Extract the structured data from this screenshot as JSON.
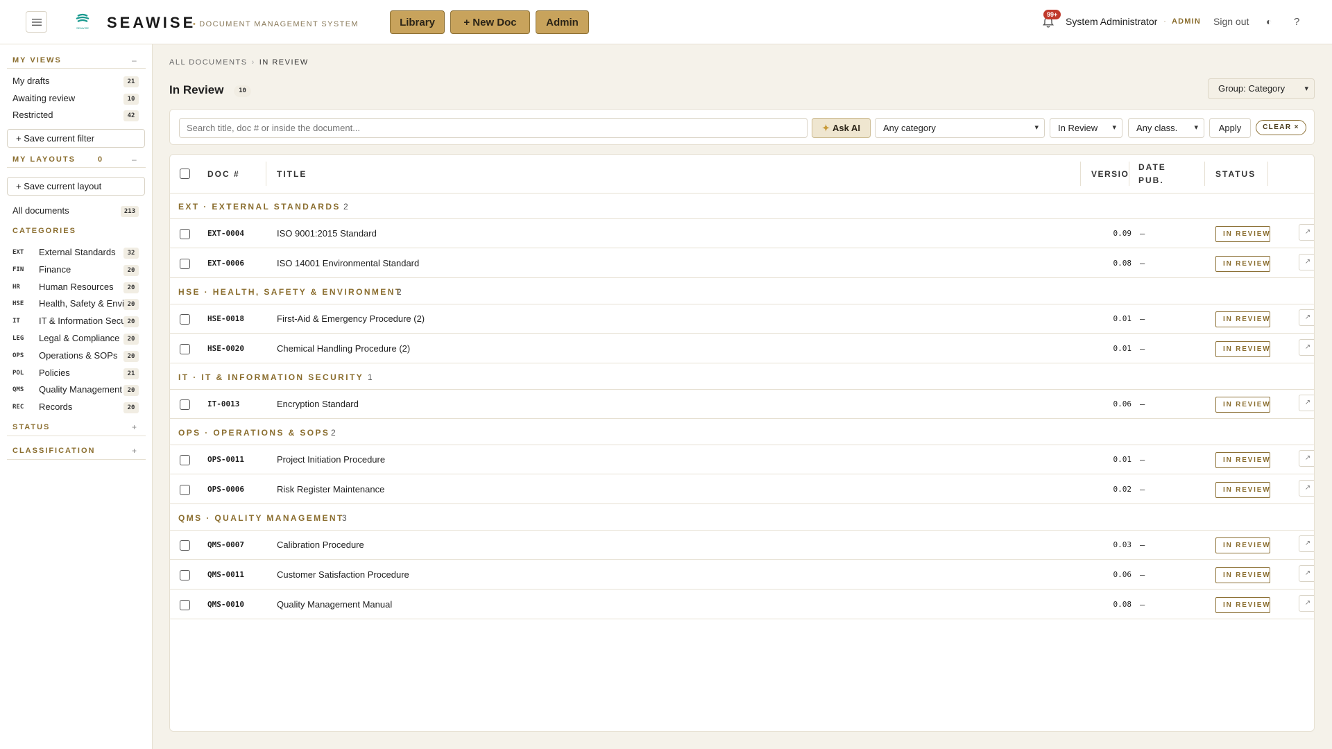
{
  "header": {
    "brand": "SEAWISE",
    "subtitle": "DOCUMENT MANAGEMENT SYSTEM",
    "logo_text": "SEAWISE",
    "nav": {
      "library": "Library",
      "new_doc": "+ New Doc",
      "admin": "Admin"
    },
    "notifications_badge": "99+",
    "user_name": "System Administrator",
    "separator": "·",
    "user_role": "ADMIN",
    "sign_out": "Sign out",
    "theme_icon": "◐",
    "help": "?",
    "accent_color": "#c8a35c"
  },
  "sidebar": {
    "my_views_heading": "MY VIEWS",
    "my_views_toggle": "–",
    "views": [
      {
        "label": "My drafts",
        "count": "21"
      },
      {
        "label": "Awaiting review",
        "count": "10"
      },
      {
        "label": "Restricted",
        "count": "42"
      }
    ],
    "save_filter": "+ Save current filter",
    "my_layouts_heading": "MY LAYOUTS",
    "my_layouts_count": "0",
    "my_layouts_toggle": "–",
    "save_layout": "+ Save current layout",
    "all_documents": {
      "label": "All documents",
      "count": "213"
    },
    "categories_heading": "CATEGORIES",
    "categories": [
      {
        "code": "EXT",
        "label": "External Standards",
        "count": "32"
      },
      {
        "code": "FIN",
        "label": "Finance",
        "count": "20"
      },
      {
        "code": "HR",
        "label": "Human Resources",
        "count": "20"
      },
      {
        "code": "HSE",
        "label": "Health, Safety & Environment",
        "count": "20"
      },
      {
        "code": "IT",
        "label": "IT & Information Security",
        "count": "20"
      },
      {
        "code": "LEG",
        "label": "Legal & Compliance",
        "count": "20"
      },
      {
        "code": "OPS",
        "label": "Operations & SOPs",
        "count": "20"
      },
      {
        "code": "POL",
        "label": "Policies",
        "count": "21"
      },
      {
        "code": "QMS",
        "label": "Quality Management",
        "count": "20"
      },
      {
        "code": "REC",
        "label": "Records",
        "count": "20"
      }
    ],
    "status_heading": "STATUS",
    "status_toggle": "+",
    "classification_heading": "CLASSIFICATION",
    "classification_toggle": "+"
  },
  "main": {
    "breadcrumb": {
      "root": "ALL DOCUMENTS",
      "separator": "›",
      "current": "IN REVIEW"
    },
    "title": "In Review",
    "title_count": "10",
    "group_by": "Group: Category",
    "filters": {
      "search_placeholder": "Search title, doc # or inside the document...",
      "ask_ai": "Ask AI",
      "category": "Any category",
      "status": "In Review",
      "classification": "Any class.",
      "apply": "Apply",
      "clear": "CLEAR ×"
    },
    "columns": {
      "doc_num": "DOC #",
      "title": "TITLE",
      "version": "VERSIO",
      "date_pub_1": "DATE",
      "date_pub_2": "PUB.",
      "status": "STATUS"
    },
    "groups": [
      {
        "label": "EXT · EXTERNAL STANDARDS",
        "count": "2",
        "rows": [
          {
            "num": "EXT-0004",
            "title": "ISO 9001:2015 Standard",
            "version": "0.09",
            "date": "–",
            "status": "IN REVIEW"
          },
          {
            "num": "EXT-0006",
            "title": "ISO 14001 Environmental Standard",
            "version": "0.08",
            "date": "–",
            "status": "IN REVIEW"
          }
        ]
      },
      {
        "label": "HSE · HEALTH, SAFETY & ENVIRONMENT",
        "count": "2",
        "rows": [
          {
            "num": "HSE-0018",
            "title": "First-Aid & Emergency Procedure (2)",
            "version": "0.01",
            "date": "–",
            "status": "IN REVIEW"
          },
          {
            "num": "HSE-0020",
            "title": "Chemical Handling Procedure (2)",
            "version": "0.01",
            "date": "–",
            "status": "IN REVIEW"
          }
        ]
      },
      {
        "label": "IT · IT & INFORMATION SECURITY",
        "count": "1",
        "rows": [
          {
            "num": "IT-0013",
            "title": "Encryption Standard",
            "version": "0.06",
            "date": "–",
            "status": "IN REVIEW"
          }
        ]
      },
      {
        "label": "OPS · OPERATIONS & SOPS",
        "count": "2",
        "rows": [
          {
            "num": "OPS-0011",
            "title": "Project Initiation Procedure",
            "version": "0.01",
            "date": "–",
            "status": "IN REVIEW"
          },
          {
            "num": "OPS-0006",
            "title": "Risk Register Maintenance",
            "version": "0.02",
            "date": "–",
            "status": "IN REVIEW"
          }
        ]
      },
      {
        "label": "QMS · QUALITY MANAGEMENT",
        "count": "3",
        "rows": [
          {
            "num": "QMS-0007",
            "title": "Calibration Procedure",
            "version": "0.03",
            "date": "–",
            "status": "IN REVIEW"
          },
          {
            "num": "QMS-0011",
            "title": "Customer Satisfaction Procedure",
            "version": "0.06",
            "date": "–",
            "status": "IN REVIEW"
          },
          {
            "num": "QMS-0010",
            "title": "Quality Management Manual",
            "version": "0.08",
            "date": "–",
            "status": "IN REVIEW"
          }
        ]
      }
    ]
  }
}
